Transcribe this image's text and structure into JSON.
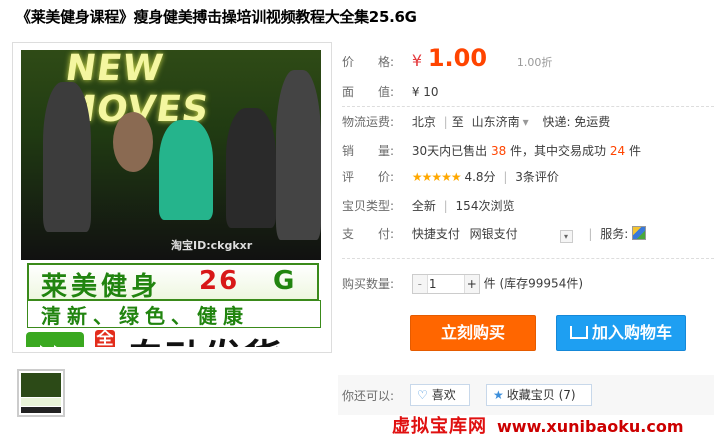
{
  "title": "《莱美健身课程》瘦身健美搏击操培训视频教程大全集25.6G",
  "image": {
    "headline": "NEW MOVES",
    "watermark_id": "淘宝ID:ckgkxr",
    "brand": "莱美健身",
    "brand_size_num": "26",
    "brand_size_unit": "G",
    "slogan": "清新、绿色、健康",
    "badge": "全天",
    "auto_ship": "自动发货"
  },
  "labels": {
    "price": "价　　格:",
    "face_value": "面　　值:",
    "shipping": "物流运费:",
    "sales": "销　　量:",
    "rating": "评　　价:",
    "type": "宝贝类型:",
    "payment": "支　　付:",
    "quantity": "购买数量:",
    "can_also": "你还可以:"
  },
  "price": {
    "symbol": "¥",
    "value": "1.00",
    "discount": "1.00折"
  },
  "face_value": "¥ 10",
  "shipping": {
    "from": "北京",
    "to_word": "至",
    "to": "山东济南",
    "express": "快递: 免运费"
  },
  "sales": {
    "prefix": "30天内已售出",
    "sold": "38",
    "mid": "件，其中交易成功",
    "success": "24",
    "suffix": "件"
  },
  "rating": {
    "stars": "★★★★★",
    "score": "4.8分",
    "reviews": "3条评价"
  },
  "type": {
    "condition": "全新",
    "views": "154次浏览"
  },
  "payment": {
    "methods": [
      "快捷支付",
      "网银支付"
    ],
    "service_label": "服务:"
  },
  "quantity": {
    "value": "1",
    "stock": "件 (库存99954件)"
  },
  "buttons": {
    "buy": "立刻购买",
    "cart": "加入购物车",
    "like": "喜欢",
    "collect": "收藏宝贝 (7)"
  },
  "watermark": {
    "cn": "虚拟宝库网",
    "url": "www.xunibaoku.com"
  },
  "colors": {
    "price": "#ff4400",
    "buy": "#ff6600",
    "cart": "#1e9ff2",
    "star": "#ffa800"
  }
}
